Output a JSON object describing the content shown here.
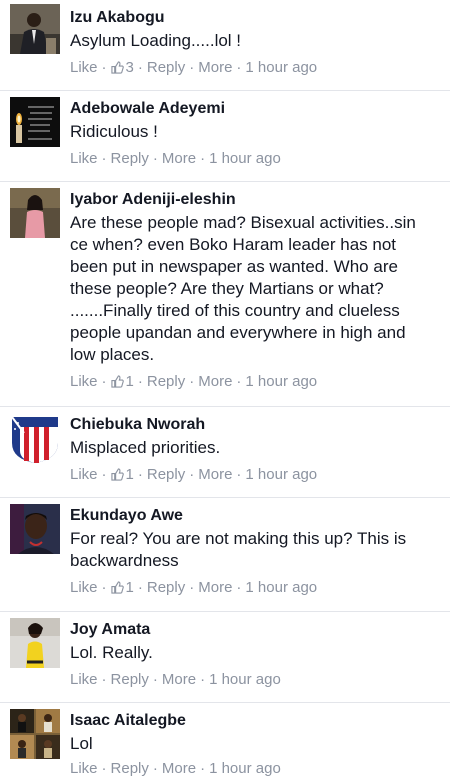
{
  "labels": {
    "like": "Like",
    "reply": "Reply",
    "more": "More",
    "dot": "·"
  },
  "comments": [
    {
      "name": "Izu Akabogu",
      "text": "Asylum Loading.....lol !",
      "likes": "3",
      "time": "1 hour ago",
      "avatar": "person-suit-avatar"
    },
    {
      "name": "Adebowale Adeyemi",
      "text": "Ridiculous !",
      "likes": "",
      "time": "1 hour ago",
      "avatar": "candle-avatar"
    },
    {
      "name": "Iyabor Adeniji-eleshin",
      "text": "Are these people mad? Bisexual activities..sin\nce when? even Boko Haram leader has not\nbeen put in newspaper as wanted. Who are\nthese people? Are they Martians or what?\n.......Finally tired of this country and clueless\npeople upandan and everywhere in high and\nlow places.",
      "likes": "1",
      "time": "1 hour ago",
      "avatar": "woman-pink-avatar"
    },
    {
      "name": "Chiebuka Nworah",
      "text": "Misplaced priorities.",
      "likes": "1",
      "time": "1 hour ago",
      "avatar": "club-crest-avatar"
    },
    {
      "name": "Ekundayo Awe",
      "text": "For real? You are not making this up? This is\nbackwardness",
      "likes": "1",
      "time": "1 hour ago",
      "avatar": "man-portrait-avatar"
    },
    {
      "name": "Joy Amata",
      "text": "Lol. Really.",
      "likes": "",
      "time": "1 hour ago",
      "avatar": "woman-yellow-avatar"
    },
    {
      "name": "Isaac Aitalegbe",
      "text": "Lol",
      "likes": "",
      "time": "1 hour ago",
      "avatar": "collage-avatar"
    }
  ]
}
